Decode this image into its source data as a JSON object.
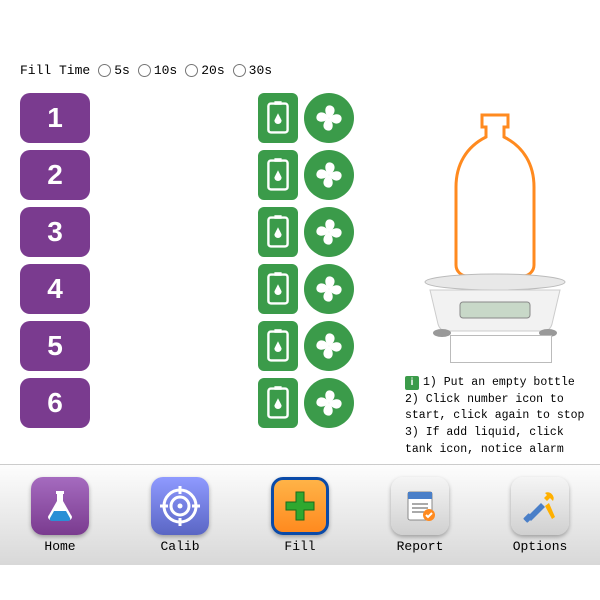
{
  "fillTime": {
    "label": "Fill Time",
    "options": [
      "5s",
      "10s",
      "20s",
      "30s"
    ]
  },
  "numbers": [
    "1",
    "2",
    "3",
    "4",
    "5",
    "6"
  ],
  "weight": "",
  "instructions": {
    "l1": "1) Put an empty bottle",
    "l2": "2) Click number icon to",
    "l3": "start, click again to stop",
    "l4": "3) If add liquid, click",
    "l5": "tank icon, notice alarm"
  },
  "info": "i",
  "nav": {
    "home": "Home",
    "calib": "Calib",
    "fill": "Fill",
    "report": "Report",
    "options": "Options"
  }
}
